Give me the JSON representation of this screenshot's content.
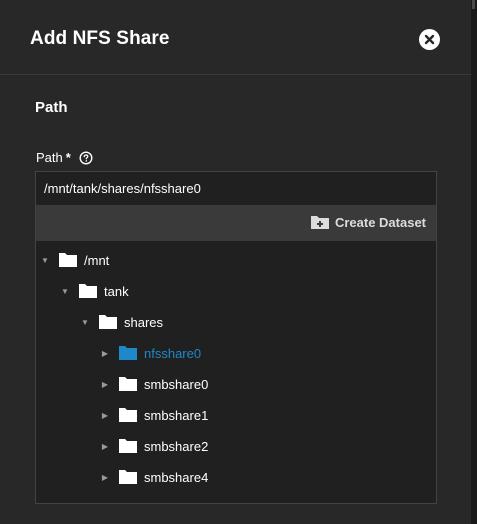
{
  "dialog": {
    "title": "Add NFS Share",
    "close_icon": "close-icon"
  },
  "section": {
    "title": "Path"
  },
  "path_field": {
    "label": "Path",
    "required_marker": "*",
    "help_icon": "help-circle-icon",
    "value": "/mnt/tank/shares/nfsshare0"
  },
  "toolbar": {
    "create_dataset_label": "Create Dataset",
    "create_dataset_icon": "folder-plus-icon"
  },
  "colors": {
    "dialog_bg": "#282828",
    "tree_bg": "#202020",
    "toolbar_bg": "#3a3a3a",
    "active_item": "#1e88c8"
  },
  "tree": [
    {
      "label": "/mnt",
      "expanded": true,
      "selected": false
    },
    {
      "label": "tank",
      "expanded": true,
      "selected": false
    },
    {
      "label": "shares",
      "expanded": true,
      "selected": false
    },
    {
      "label": "nfsshare0",
      "expanded": false,
      "selected": true
    },
    {
      "label": "smbshare0",
      "expanded": false,
      "selected": false
    },
    {
      "label": "smbshare1",
      "expanded": false,
      "selected": false
    },
    {
      "label": "smbshare2",
      "expanded": false,
      "selected": false
    },
    {
      "label": "smbshare4",
      "expanded": false,
      "selected": false
    }
  ]
}
